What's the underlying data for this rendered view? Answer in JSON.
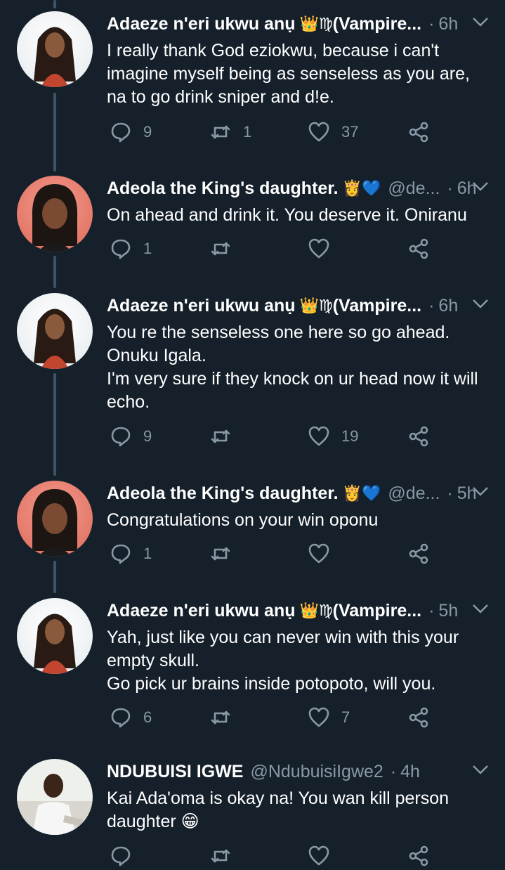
{
  "tweets": [
    {
      "author": "Adaeze n'eri ukwu anụ",
      "badges": "👑♍",
      "author_suffix": "(Vampire...",
      "handle": "",
      "dot": "·",
      "time": "6h",
      "text": "I really thank God eziokwu, because i can't\nimagine myself being as senseless as you are,\nna to go drink sniper and d!e.",
      "replies": "9",
      "retweets": "1",
      "likes": "37",
      "avatar": "avatar-adaeze"
    },
    {
      "author": "Adeola the King's daughter.",
      "badges": "👸💙",
      "author_suffix": "",
      "handle": "@de...",
      "dot": "·",
      "time": "6h",
      "text": "On ahead and drink it. You deserve it. Oniranu",
      "replies": "1",
      "retweets": "",
      "likes": "",
      "avatar": "avatar-adeola"
    },
    {
      "author": "Adaeze n'eri ukwu anụ",
      "badges": "👑♍",
      "author_suffix": "(Vampire...",
      "handle": "",
      "dot": "·",
      "time": "6h",
      "text": "You re the senseless one here so go ahead.\nOnuku Igala.\nI'm very sure if they knock on ur head now it will\necho.",
      "replies": "9",
      "retweets": "",
      "likes": "19",
      "avatar": "avatar-adaeze"
    },
    {
      "author": "Adeola the King's daughter.",
      "badges": "👸💙",
      "author_suffix": "",
      "handle": "@de...",
      "dot": "·",
      "time": "5h",
      "text": "Congratulations on your win oponu",
      "replies": "1",
      "retweets": "",
      "likes": "",
      "avatar": "avatar-adeola"
    },
    {
      "author": "Adaeze n'eri ukwu anụ",
      "badges": "👑♍",
      "author_suffix": "(Vampire...",
      "handle": "",
      "dot": "·",
      "time": "5h",
      "text": "Yah, just like you can never win with this your\nempty skull.\nGo pick ur brains inside potopoto, will you.",
      "replies": "6",
      "retweets": "",
      "likes": "7",
      "avatar": "avatar-adaeze"
    },
    {
      "author": "NDUBUISI IGWE",
      "badges": "",
      "author_suffix": "",
      "handle": "@NdubuisiIgwe2",
      "dot": "·",
      "time": "4h",
      "text": "Kai Ada'oma is okay na! You wan kill person\ndaughter 😁",
      "replies": "",
      "retweets": "",
      "likes": "",
      "avatar": "avatar-ndubuisi"
    }
  ],
  "colors": {
    "background": "#15202b",
    "text_primary": "#ffffff",
    "text_secondary": "#8899a6",
    "thread_line": "#3d5466"
  },
  "icons": {
    "reply": "reply-icon",
    "retweet": "retweet-icon",
    "like": "like-icon",
    "share": "share-icon",
    "caret": "chevron-down-icon"
  }
}
